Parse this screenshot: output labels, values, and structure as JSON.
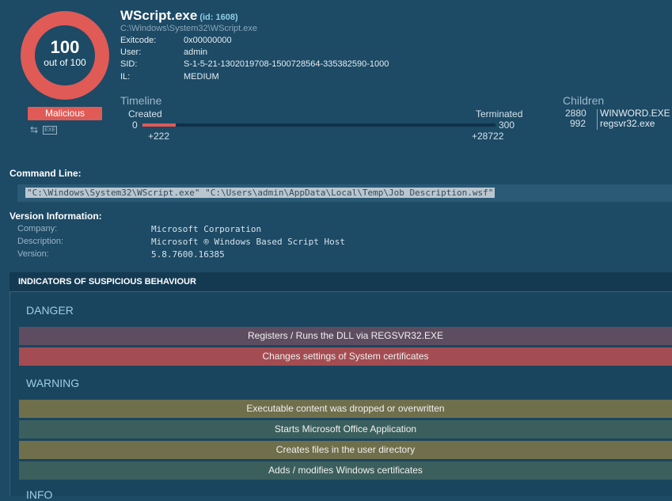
{
  "score": {
    "value": "100",
    "subtitle": "out of 100",
    "verdict": "Malicious"
  },
  "process": {
    "name": "WScript.exe",
    "id_label": "(id: 1608)",
    "path": "C:\\Windows\\System32\\WScript.exe",
    "fields": [
      {
        "key": "Exitcode:",
        "value": "0x00000000"
      },
      {
        "key": "User:",
        "value": "admin"
      },
      {
        "key": "SID:",
        "value": "S-1-5-21-1302019708-1500728564-335382590-1000"
      },
      {
        "key": "IL:",
        "value": "MEDIUM"
      }
    ]
  },
  "icons": [
    "swap-arrows-icon",
    "exe-icon"
  ],
  "exe_icon_text": "EXE",
  "timeline": {
    "label": "Timeline",
    "created_label": "Created",
    "terminated_label": "Terminated",
    "start": "0",
    "end": "300",
    "created_offset": "+222",
    "terminated_offset": "+28722",
    "bar_color": "#e05a56"
  },
  "children": {
    "label": "Children",
    "items": [
      {
        "pid": "2880",
        "name": "WINWORD.EXE"
      },
      {
        "pid": "992",
        "name": "regsvr32.exe"
      }
    ]
  },
  "command_line": {
    "label": "Command Line:",
    "value": "\"C:\\Windows\\System32\\WScript.exe\" \"C:\\Users\\admin\\AppData\\Local\\Temp\\Job Description.wsf\""
  },
  "version": {
    "label": "Version Information:",
    "fields": [
      {
        "key": "Company:",
        "value": "Microsoft Corporation"
      },
      {
        "key": "Description:",
        "value": "Microsoft ® Windows Based Script Host"
      },
      {
        "key": "Version:",
        "value": "5.8.7600.16385"
      }
    ]
  },
  "indicators": {
    "header": "INDICATORS OF SUSPICIOUS BEHAVIOUR",
    "danger_label": "DANGER",
    "danger": [
      "Registers / Runs the DLL via REGSVR32.EXE",
      "Changes settings of System certificates"
    ],
    "warning_label": "WARNING",
    "warning": [
      "Executable content was dropped or overwritten",
      "Starts Microsoft Office Application",
      "Creates files in the user directory",
      "Adds / modifies Windows certificates"
    ],
    "info_label": "INFO"
  },
  "colors": {
    "accent": "#e05a56",
    "background": "#1d4a65",
    "danger_light": "#5e4d60",
    "danger_strong": "#a34d52",
    "warning_olive": "#6f6f4c",
    "warning_teal": "#3b5f5c"
  }
}
